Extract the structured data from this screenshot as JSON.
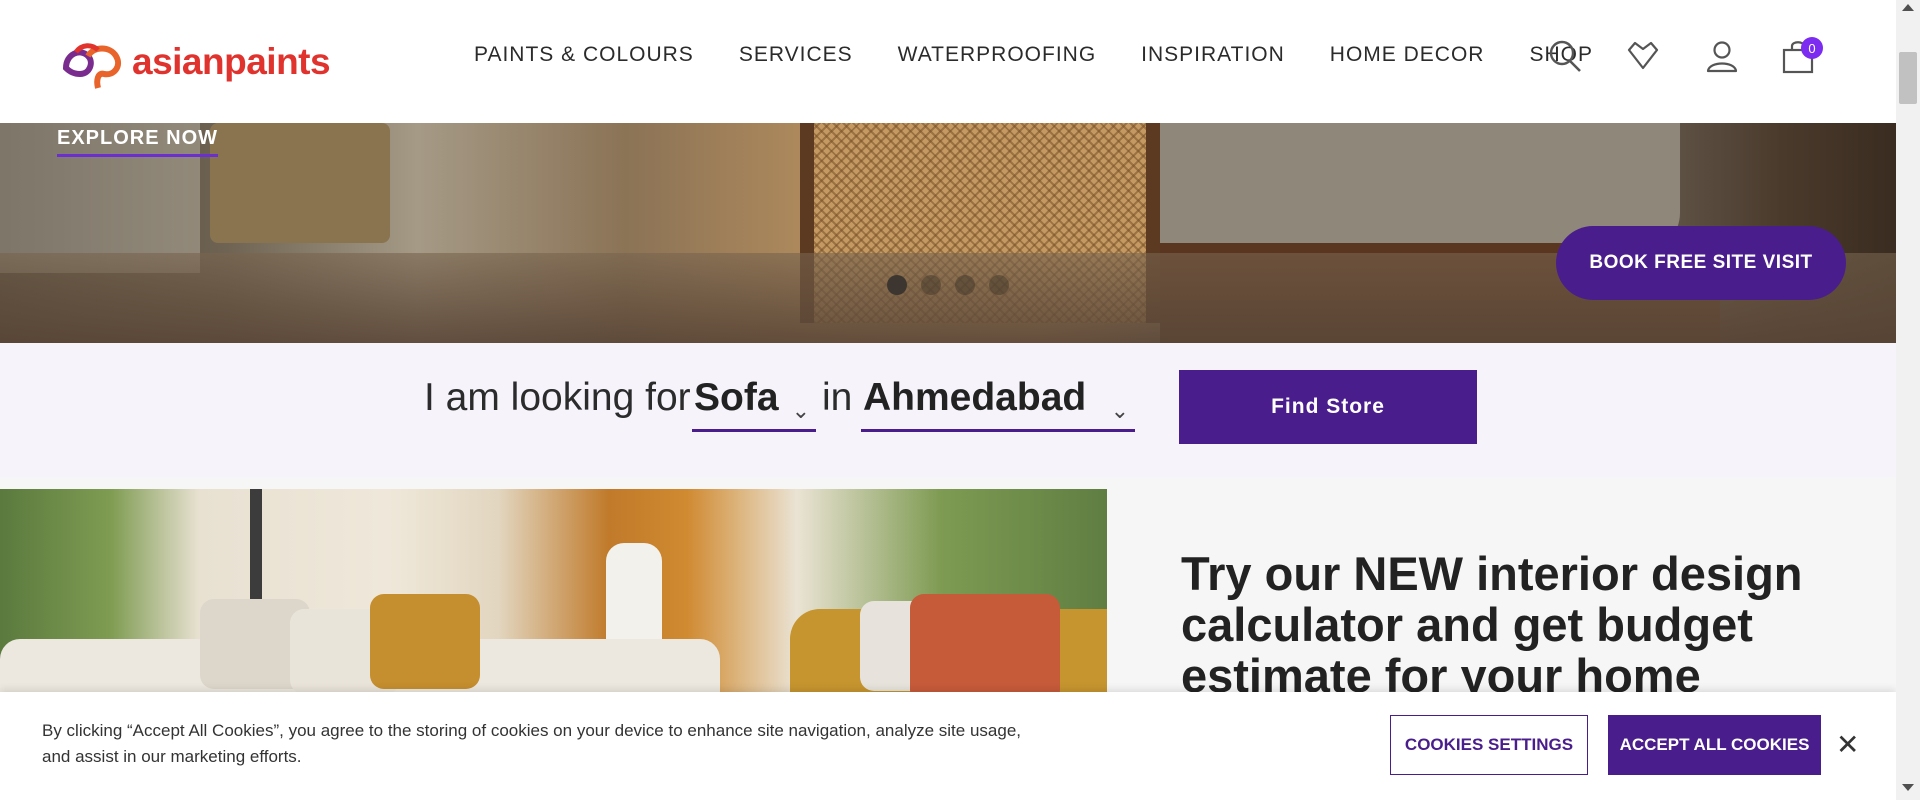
{
  "header": {
    "logo_text": "asianpaints",
    "nav": [
      "PAINTS & COLOURS",
      "SERVICES",
      "WATERPROOFING",
      "INSPIRATION",
      "HOME DECOR",
      "SHOP"
    ],
    "cart_count": "0",
    "icons": [
      "search-icon",
      "wishlist-icon",
      "user-icon",
      "cart-icon"
    ]
  },
  "hero": {
    "explore_label": "EXPLORE NOW",
    "book_label": "BOOK FREE SITE VISIT",
    "slide_count": 4,
    "active_slide": 1
  },
  "finder": {
    "prefix": "I am looking for",
    "category_value": "Sofa",
    "connector": "in",
    "city_value": "Ahmedabad",
    "button_label": "Find Store"
  },
  "promo": {
    "heading": "Try our NEW interior design calculator and get budget estimate for your home"
  },
  "cookie": {
    "text": "By clicking “Accept All Cookies”, you agree to the storing of cookies on your device to enhance site navigation, analyze site usage, and assist in our marketing efforts.",
    "settings_label": "COOKIES SETTINGS",
    "accept_label": "ACCEPT ALL COOKIES",
    "close_label": "✕"
  },
  "colors": {
    "brand_purple": "#4a1d8c",
    "logo_red": "#e0332e",
    "badge_purple": "#7b2cf0"
  }
}
